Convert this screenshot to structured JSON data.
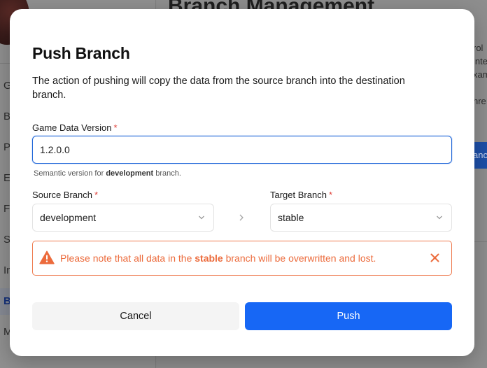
{
  "background": {
    "page_title": "Branch Management",
    "nav_items": [
      "G",
      "B",
      "P",
      "E",
      "F",
      "S",
      "In",
      "B",
      "M"
    ],
    "side_text": [
      "rol",
      "inte",
      "xam",
      "hre"
    ],
    "side_button_label": "anc"
  },
  "modal": {
    "title": "Push Branch",
    "description": "The action of pushing will copy the data from the source branch into the destination branch.",
    "version": {
      "label": "Game Data Version",
      "required_mark": "*",
      "value": "1.2.0.0",
      "hint_prefix": "Semantic version for ",
      "hint_branch": "development",
      "hint_suffix": " branch."
    },
    "source": {
      "label": "Source Branch",
      "required_mark": "*",
      "value": "development"
    },
    "target": {
      "label": "Target Branch",
      "required_mark": "*",
      "value": "stable"
    },
    "alert": {
      "prefix": "Please note that all data in the ",
      "branch": "stable",
      "suffix": " branch will be overwritten and lost.",
      "icon": "warning-icon",
      "color": "#ec6b3c"
    },
    "buttons": {
      "cancel": "Cancel",
      "push": "Push"
    }
  },
  "colors": {
    "primary": "#1767f5",
    "required": "#e0443d",
    "warning": "#ec6b3c",
    "focus_border": "#1f66d8"
  }
}
